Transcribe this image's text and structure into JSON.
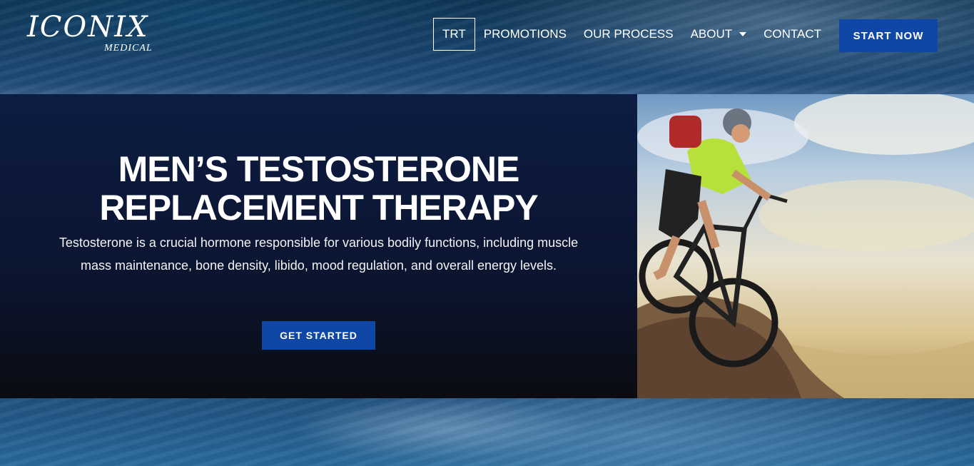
{
  "brand": {
    "name": "ICONIX",
    "sub": "MEDICAL"
  },
  "nav": {
    "items": [
      {
        "label": "TRT",
        "active": true
      },
      {
        "label": "PROMOTIONS"
      },
      {
        "label": "OUR PROCESS"
      },
      {
        "label": "ABOUT",
        "dropdown": true
      },
      {
        "label": "CONTACT"
      }
    ],
    "cta": "START NOW"
  },
  "hero": {
    "title_line1": "MEN’S TESTOSTERONE",
    "title_line2": "REPLACEMENT THERAPY",
    "text": "Testosterone is a crucial hormone responsible for various bodily functions, including muscle mass maintenance, bone density, libido, mood regulation, and overall energy levels.",
    "button": "GET STARTED"
  },
  "colors": {
    "accent": "#0f47a6",
    "hero_bg": "#0b1530"
  }
}
